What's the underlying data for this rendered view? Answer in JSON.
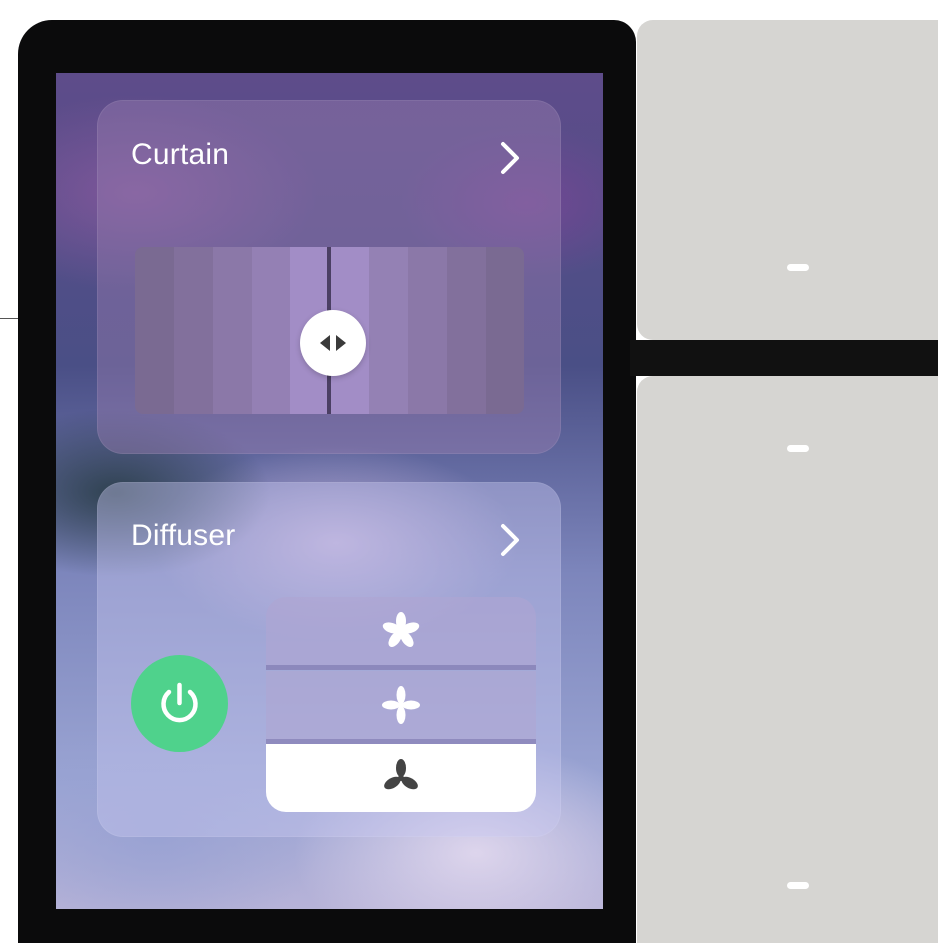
{
  "curtain": {
    "title": "Curtain",
    "chevron_icon": "chevron-right-icon",
    "handle_icon": "slide-left-right-icon"
  },
  "diffuser": {
    "title": "Diffuser",
    "chevron_icon": "chevron-right-icon",
    "power": {
      "icon": "power-icon",
      "state": "on",
      "color": "#4fd28c"
    },
    "speeds": [
      {
        "level": "high",
        "icon": "fan-high-icon",
        "selected": false
      },
      {
        "level": "medium",
        "icon": "fan-medium-icon",
        "selected": false
      },
      {
        "level": "low",
        "icon": "fan-low-icon",
        "selected": true
      }
    ]
  },
  "colors": {
    "frame": "#0b0b0c",
    "side_panel": "#d6d5d2",
    "power_on": "#4fd28c"
  }
}
